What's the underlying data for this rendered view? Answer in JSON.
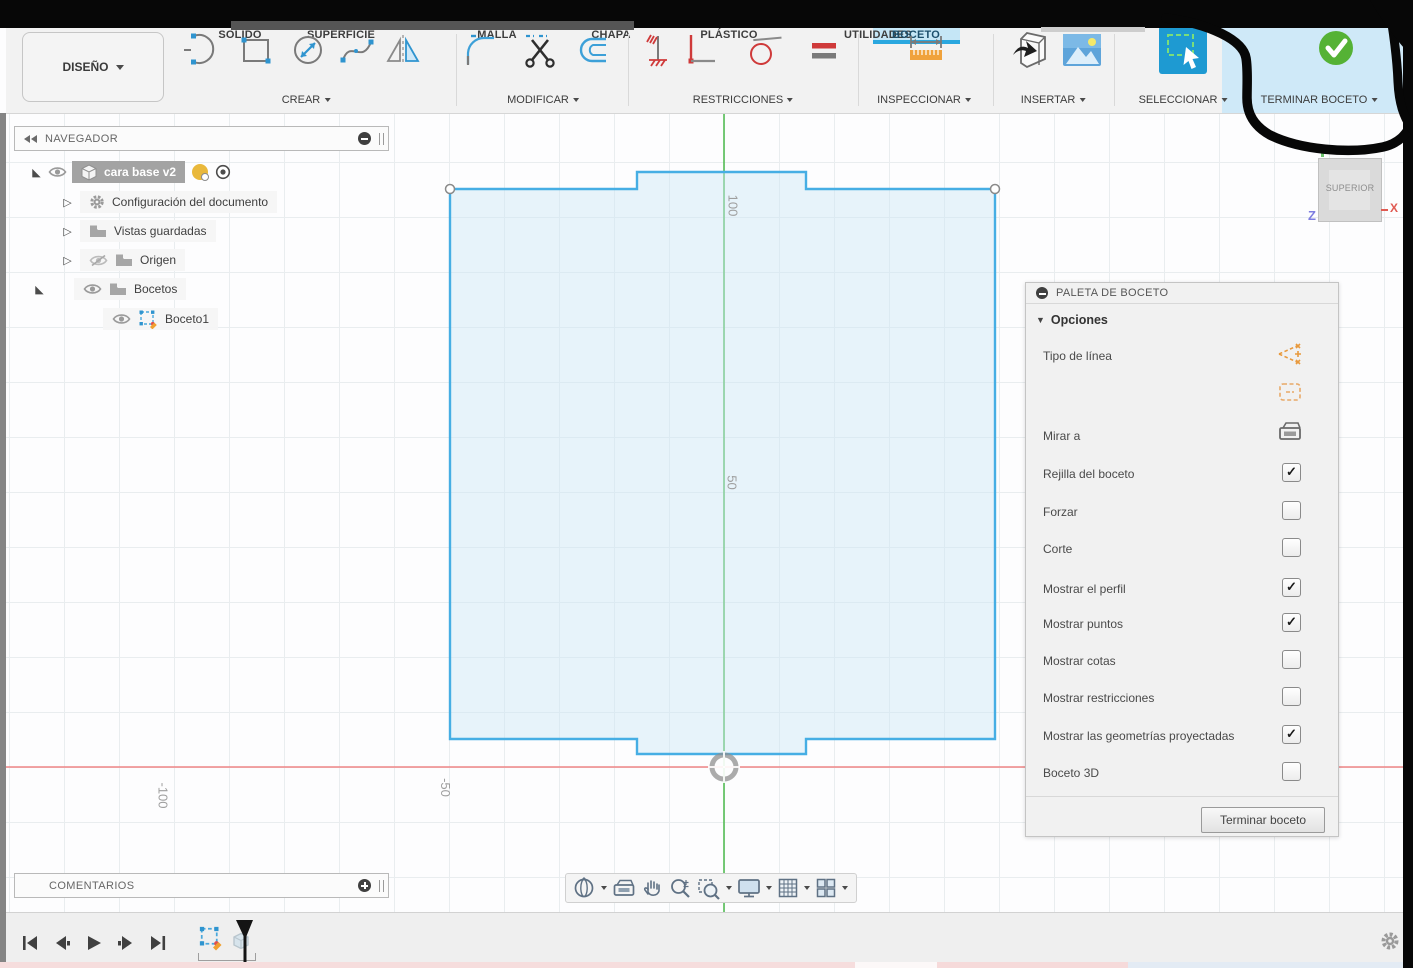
{
  "toolbar": {
    "design_menu": "DISEÑO",
    "tabs": [
      {
        "label": "SOLIDO"
      },
      {
        "label": "SUPERFICIE"
      },
      {
        "label": "MALLA"
      },
      {
        "label": "CHAPA"
      },
      {
        "label": "PLÁSTICO"
      },
      {
        "label": "UTILIDADES"
      },
      {
        "label": "BOCETO",
        "active": true
      }
    ],
    "groups": [
      {
        "label": "CREAR"
      },
      {
        "label": "MODIFICAR"
      },
      {
        "label": "RESTRICCIONES"
      },
      {
        "label": "INSPECCIONAR"
      },
      {
        "label": "INSERTAR"
      },
      {
        "label": "SELECCIONAR"
      },
      {
        "label": "TERMINAR BOCETO"
      }
    ],
    "accent_blue": "#2aa7df",
    "finish_green": "#55b235"
  },
  "navigator": {
    "title": "NAVEGADOR",
    "items": [
      {
        "arrow": "◣",
        "label": "cara base v2",
        "selected": true
      },
      {
        "arrow": "▷",
        "label": "Configuración del documento"
      },
      {
        "arrow": "▷",
        "label": "Vistas guardadas"
      },
      {
        "arrow": "▷",
        "label": "Origen",
        "visibility": "hidden"
      },
      {
        "arrow": "◣",
        "label": "Bocetos"
      },
      {
        "arrow": "",
        "label": "Boceto1"
      }
    ]
  },
  "palette": {
    "title": "PALETA DE BOCETO",
    "section": "Opciones",
    "section_arrow": "▼",
    "rows": [
      {
        "label": "Tipo de línea",
        "control": "linetype-icons",
        "check": ""
      },
      {
        "label": "Mirar a",
        "control": "look-at-icon",
        "check": ""
      },
      {
        "label": "Rejilla del boceto",
        "control": "checkbox",
        "check": "✓"
      },
      {
        "label": "Forzar",
        "control": "checkbox",
        "check": ""
      },
      {
        "label": "Corte",
        "control": "checkbox",
        "check": ""
      },
      {
        "label": "Mostrar el perfil",
        "control": "checkbox",
        "check": "✓"
      },
      {
        "label": "Mostrar puntos",
        "control": "checkbox",
        "check": "✓"
      },
      {
        "label": "Mostrar cotas",
        "control": "checkbox",
        "check": ""
      },
      {
        "label": "Mostrar restricciones",
        "control": "checkbox",
        "check": ""
      },
      {
        "label": "Mostrar las geometrías proyectadas",
        "control": "checkbox",
        "check": "✓"
      },
      {
        "label": "Boceto 3D",
        "control": "checkbox",
        "check": ""
      }
    ],
    "finish_button": "Terminar boceto"
  },
  "canvas": {
    "axis_labels": {
      "y100": "100",
      "y50": "50",
      "xm50": "-50",
      "xm100": "-100"
    },
    "sketch_line_color": "#46aee4",
    "x_axis_color": "#ef8585",
    "y_axis_color": "#54bd54"
  },
  "viewcube": {
    "face": "SUPERIOR",
    "axis_x": "X",
    "axis_z": "Z"
  },
  "comments": {
    "title": "COMENTARIOS"
  }
}
